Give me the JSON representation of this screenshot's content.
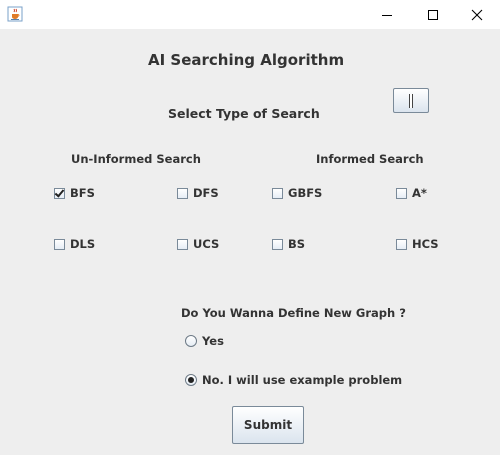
{
  "window": {
    "app_icon": "java-cup-icon",
    "controls": [
      "minimize-icon",
      "maximize-icon",
      "close-icon"
    ]
  },
  "header": {
    "title": "AI Searching Algorithm",
    "select_label": "Select Type of Search",
    "info_button_label": "i"
  },
  "search_types": {
    "uninformed_label": "Un-Informed Search",
    "informed_label": "Informed Search",
    "options": {
      "bfs": {
        "label": "BFS",
        "checked": true
      },
      "dfs": {
        "label": "DFS",
        "checked": false
      },
      "gbfs": {
        "label": "GBFS",
        "checked": false
      },
      "astar": {
        "label": "A*",
        "checked": false
      },
      "dls": {
        "label": "DLS",
        "checked": false
      },
      "ucs": {
        "label": "UCS",
        "checked": false
      },
      "bs": {
        "label": "BS",
        "checked": false
      },
      "hcs": {
        "label": "HCS",
        "checked": false
      }
    }
  },
  "graph_question": {
    "question": "Do You Wanna Define New Graph ?",
    "yes_label": "Yes",
    "no_label": "No. I will use example problem",
    "selected": "no"
  },
  "submit_label": "Submit"
}
